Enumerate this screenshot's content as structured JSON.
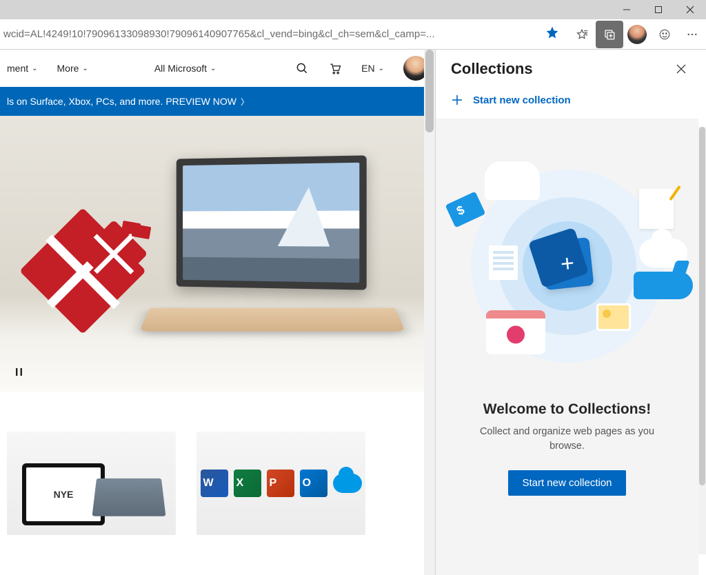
{
  "titlebar": {},
  "address_bar": {
    "url": "wcid=AL!4249!10!79096133098930!79096140907765&cl_vend=bing&cl_ch=sem&cl_camp=..."
  },
  "site_nav": {
    "item1": "ment",
    "item2": "More",
    "item3": "All Microsoft",
    "lang": "EN"
  },
  "promo_banner": {
    "text": "ls on Surface, Xbox, PCs, and more. PREVIEW NOW"
  },
  "hero": {
    "pause_label": "II"
  },
  "tiles": {
    "tablet_text": "NYE"
  },
  "collections": {
    "title": "Collections",
    "start_link": "Start new collection",
    "welcome_title": "Welcome to Collections!",
    "welcome_text": "Collect and organize web pages as you browse.",
    "button": "Start new collection"
  }
}
